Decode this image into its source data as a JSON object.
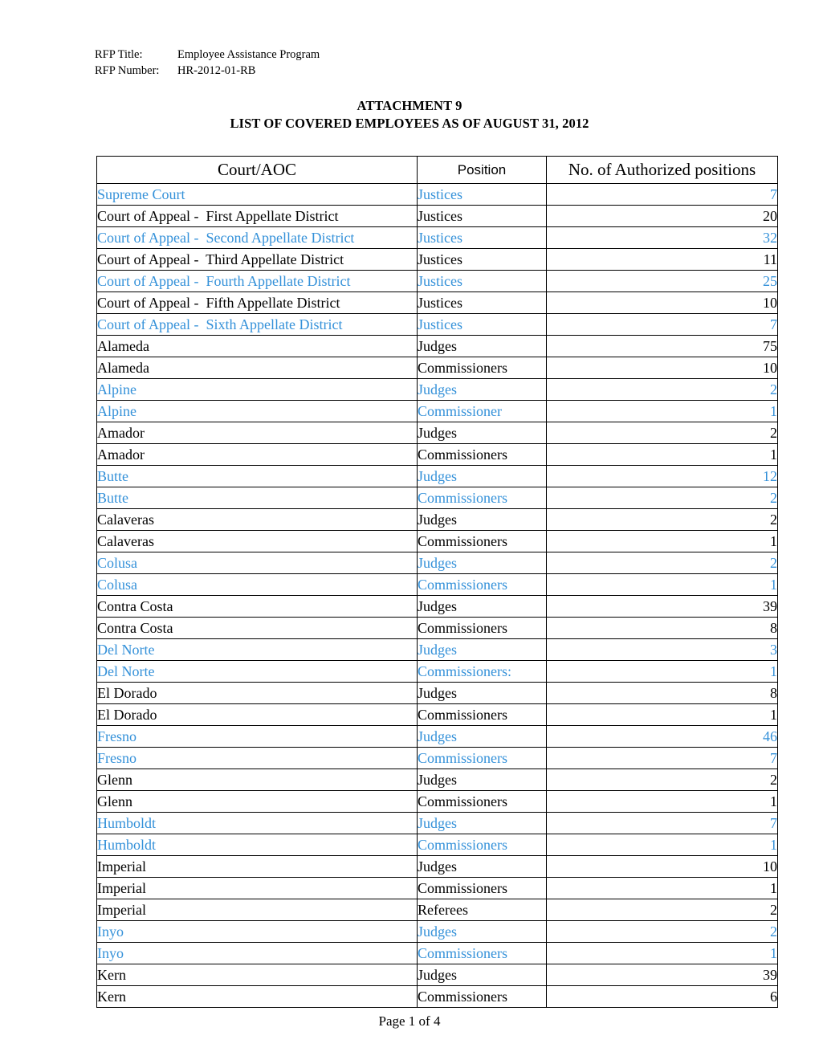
{
  "rfp": {
    "title_label": "RFP Title:",
    "title_value": "Employee Assistance Program",
    "number_label": "RFP Number:",
    "number_value": "HR-2012-01-RB"
  },
  "doc": {
    "attachment": "ATTACHMENT 9",
    "subtitle": "LIST OF COVERED EMPLOYEES AS OF AUGUST 31, 2012"
  },
  "colors": {
    "accent_blue": "#3491d9",
    "text_black": "#000000",
    "border": "#000000"
  },
  "table": {
    "headers": {
      "court": "Court/AOC",
      "position": "Position",
      "number": "No. of Authorized positions"
    },
    "rows": [
      {
        "court": "Supreme Court",
        "position": "Justices",
        "number": "7",
        "color": "blue"
      },
      {
        "court": "Court of Appeal -  First Appellate District",
        "position": "Justices",
        "number": "20",
        "color": "black"
      },
      {
        "court": "Court of Appeal -  Second Appellate District",
        "position": "Justices",
        "number": "32",
        "color": "blue"
      },
      {
        "court": "Court of Appeal -  Third Appellate District",
        "position": "Justices",
        "number": "11",
        "color": "black"
      },
      {
        "court": "Court of Appeal -  Fourth Appellate District",
        "position": "Justices",
        "number": "25",
        "color": "blue"
      },
      {
        "court": "Court of Appeal -  Fifth Appellate District",
        "position": "Justices",
        "number": "10",
        "color": "black"
      },
      {
        "court": "Court of Appeal -  Sixth Appellate District",
        "position": "Justices",
        "number": "7",
        "color": "blue"
      },
      {
        "court": "Alameda",
        "position": "Judges",
        "number": "75",
        "color": "black"
      },
      {
        "court": "Alameda",
        "position": "Commissioners",
        "number": "10",
        "color": "black"
      },
      {
        "court": "Alpine",
        "position": "Judges",
        "number": "2",
        "color": "blue"
      },
      {
        "court": "Alpine",
        "position": "Commissioner",
        "number": "1",
        "color": "blue"
      },
      {
        "court": "Amador",
        "position": "Judges",
        "number": "2",
        "color": "black"
      },
      {
        "court": "Amador",
        "position": "Commissioners",
        "number": "1",
        "color": "black"
      },
      {
        "court": "Butte",
        "position": "Judges",
        "number": "12",
        "color": "blue"
      },
      {
        "court": "Butte",
        "position": "Commissioners",
        "number": "2",
        "color": "blue"
      },
      {
        "court": "Calaveras",
        "position": "Judges",
        "number": "2",
        "color": "black"
      },
      {
        "court": "Calaveras",
        "position": "Commissioners",
        "number": "1",
        "color": "black"
      },
      {
        "court": "Colusa",
        "position": "Judges",
        "number": "2",
        "color": "blue"
      },
      {
        "court": "Colusa",
        "position": "Commissioners",
        "number": "1",
        "color": "blue"
      },
      {
        "court": "Contra Costa",
        "position": "Judges",
        "number": "39",
        "color": "black"
      },
      {
        "court": "Contra Costa",
        "position": "Commissioners",
        "number": "8",
        "color": "black"
      },
      {
        "court": "Del Norte",
        "position": "Judges",
        "number": "3",
        "color": "blue"
      },
      {
        "court": "Del Norte",
        "position": "Commissioners:",
        "number": "1",
        "color": "blue"
      },
      {
        "court": "El Dorado",
        "position": "Judges",
        "number": "8",
        "color": "black"
      },
      {
        "court": "El Dorado",
        "position": "Commissioners",
        "number": "1",
        "color": "black"
      },
      {
        "court": "Fresno",
        "position": "Judges",
        "number": "46",
        "color": "blue"
      },
      {
        "court": "Fresno",
        "position": "Commissioners",
        "number": "7",
        "color": "blue"
      },
      {
        "court": "Glenn",
        "position": "Judges",
        "number": "2",
        "color": "black"
      },
      {
        "court": "Glenn",
        "position": "Commissioners",
        "number": "1",
        "color": "black"
      },
      {
        "court": "Humboldt",
        "position": "Judges",
        "number": "7",
        "color": "blue"
      },
      {
        "court": "Humboldt",
        "position": "Commissioners",
        "number": "1",
        "color": "blue"
      },
      {
        "court": "Imperial",
        "position": "Judges",
        "number": "10",
        "color": "black"
      },
      {
        "court": "Imperial",
        "position": "Commissioners",
        "number": "1",
        "color": "black"
      },
      {
        "court": "Imperial",
        "position": "Referees",
        "number": "2",
        "color": "black"
      },
      {
        "court": "Inyo",
        "position": "Judges",
        "number": "2",
        "color": "blue"
      },
      {
        "court": "Inyo",
        "position": "Commissioners",
        "number": "1",
        "color": "blue"
      },
      {
        "court": "Kern",
        "position": "Judges",
        "number": "39",
        "color": "black"
      },
      {
        "court": "Kern",
        "position": "Commissioners",
        "number": "6",
        "color": "black"
      }
    ]
  },
  "footer": {
    "page_label": "Page 1 of 4"
  }
}
